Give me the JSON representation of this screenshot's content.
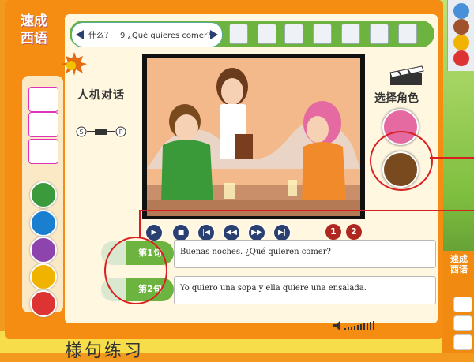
{
  "app": {
    "title_line1": "速成",
    "title_line2": "西语"
  },
  "toolbar": {
    "breadcrumb": "什么？　9 ¿Qué quieres comer？",
    "icons": [
      "film-icon",
      "document-icon",
      "notes-icon",
      "font-larger-icon",
      "font-smaller-icon",
      "check-icon",
      "edit-icon"
    ]
  },
  "mode": {
    "label": "人机对话",
    "ab_left": "S",
    "ab_right": "P"
  },
  "roles": {
    "label": "选择角色"
  },
  "video": {
    "buttons": [
      "play",
      "stop",
      "previous",
      "rewind",
      "forward",
      "next"
    ],
    "line_numbers": [
      "1",
      "2"
    ]
  },
  "dialogue": [
    {
      "tab": "第1句",
      "text": "Buenas noches. ¿Qué quieren comer?"
    },
    {
      "tab": "第2句",
      "text": "Yo quiero una sopa y ella quiere una ensalada."
    }
  ],
  "bottom": {
    "text": "様句练习"
  },
  "mini_app": {
    "title_line1": "速成",
    "title_line2": "西语"
  },
  "colors": {
    "frame": "#f58d12",
    "accent_green": "#6db33f",
    "highlight": "#d92020",
    "control": "#2a4070"
  }
}
